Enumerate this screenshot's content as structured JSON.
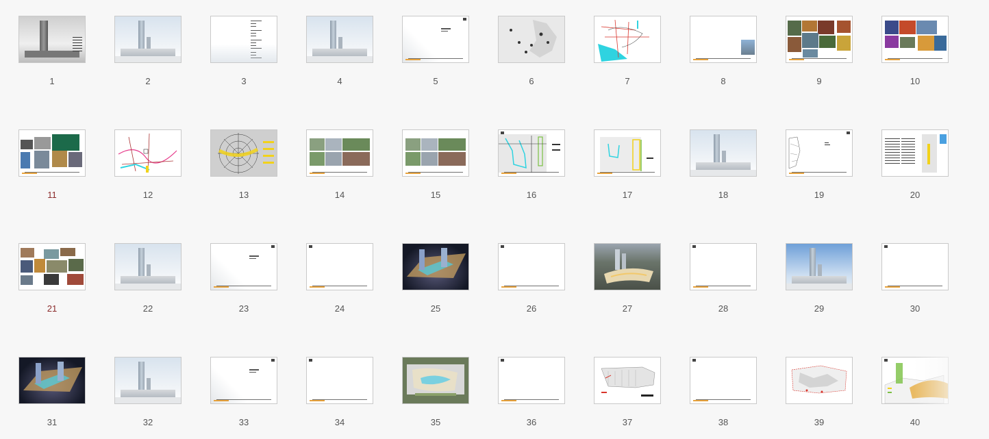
{
  "slides": [
    {
      "n": "1",
      "type": "photo-bw"
    },
    {
      "n": "2",
      "type": "tower"
    },
    {
      "n": "3",
      "type": "textlist"
    },
    {
      "n": "4",
      "type": "tower"
    },
    {
      "n": "5",
      "type": "heading"
    },
    {
      "n": "6",
      "type": "map-gray"
    },
    {
      "n": "7",
      "type": "map-river"
    },
    {
      "n": "8",
      "type": "small-photo"
    },
    {
      "n": "9",
      "type": "collage"
    },
    {
      "n": "10",
      "type": "collage2"
    },
    {
      "n": "11",
      "type": "collage3"
    },
    {
      "n": "12",
      "type": "map-roads"
    },
    {
      "n": "13",
      "type": "map-radial"
    },
    {
      "n": "14",
      "type": "site-photos"
    },
    {
      "n": "15",
      "type": "site-photos"
    },
    {
      "n": "16",
      "type": "plan-lines"
    },
    {
      "n": "17",
      "type": "plan-lines2"
    },
    {
      "n": "18",
      "type": "tower"
    },
    {
      "n": "19",
      "type": "plan-sketch"
    },
    {
      "n": "20",
      "type": "text-plan"
    },
    {
      "n": "21",
      "type": "collage4"
    },
    {
      "n": "22",
      "type": "tower"
    },
    {
      "n": "23",
      "type": "heading"
    },
    {
      "n": "24",
      "type": "blank"
    },
    {
      "n": "25",
      "type": "render-night"
    },
    {
      "n": "26",
      "type": "blank"
    },
    {
      "n": "27",
      "type": "render-aerial"
    },
    {
      "n": "28",
      "type": "blank"
    },
    {
      "n": "29",
      "type": "tower-sky"
    },
    {
      "n": "30",
      "type": "blank"
    },
    {
      "n": "31",
      "type": "render-night"
    },
    {
      "n": "32",
      "type": "tower"
    },
    {
      "n": "33",
      "type": "heading"
    },
    {
      "n": "34",
      "type": "blank"
    },
    {
      "n": "35",
      "type": "masterplan"
    },
    {
      "n": "36",
      "type": "blank"
    },
    {
      "n": "37",
      "type": "floorplan"
    },
    {
      "n": "38",
      "type": "blank"
    },
    {
      "n": "39",
      "type": "floorplan2"
    },
    {
      "n": "40",
      "type": "section"
    }
  ],
  "colors": {
    "accent": "#e8a33d",
    "cyan": "#2fd3e0",
    "yellow": "#f2d21a",
    "green": "#7bc043",
    "red": "#d9342b"
  }
}
